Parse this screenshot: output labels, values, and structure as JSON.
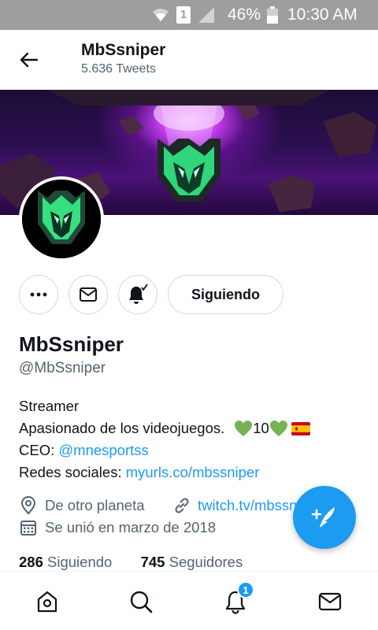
{
  "status_bar": {
    "battery": "46%",
    "time": "10:30 AM",
    "sim": "1"
  },
  "header": {
    "name": "MbSsniper",
    "tweet_count": "5.636 Tweets"
  },
  "profile": {
    "display_name": "MbSsniper",
    "handle": "@MbSsniper",
    "follow_button": "Siguiendo",
    "bio": {
      "line1": "Streamer",
      "line2_text": "Apasionado de los videojuegos.",
      "line2_number": "10",
      "line3_label": "CEO: ",
      "line3_link": "@mnesportss",
      "line4_label": "Redes sociales: ",
      "line4_link": "myurls.co/mbssniper"
    },
    "location": "De otro planeta",
    "website": "twitch.tv/mbssniper",
    "joined": "Se unió en marzo de 2018",
    "following_count": "286",
    "following_label": "Siguiendo",
    "followers_count": "745",
    "followers_label": "Seguidores"
  },
  "bottom_nav": {
    "notification_badge": "1",
    "items": [
      "home-icon",
      "search-icon",
      "notifications-icon",
      "messages-icon"
    ]
  },
  "colors": {
    "accent": "#1d9bf0",
    "text": "#0f1419",
    "secondary_text": "#536471",
    "status_bar": "#9e9e9e",
    "logo_green": "#3ddc84"
  }
}
